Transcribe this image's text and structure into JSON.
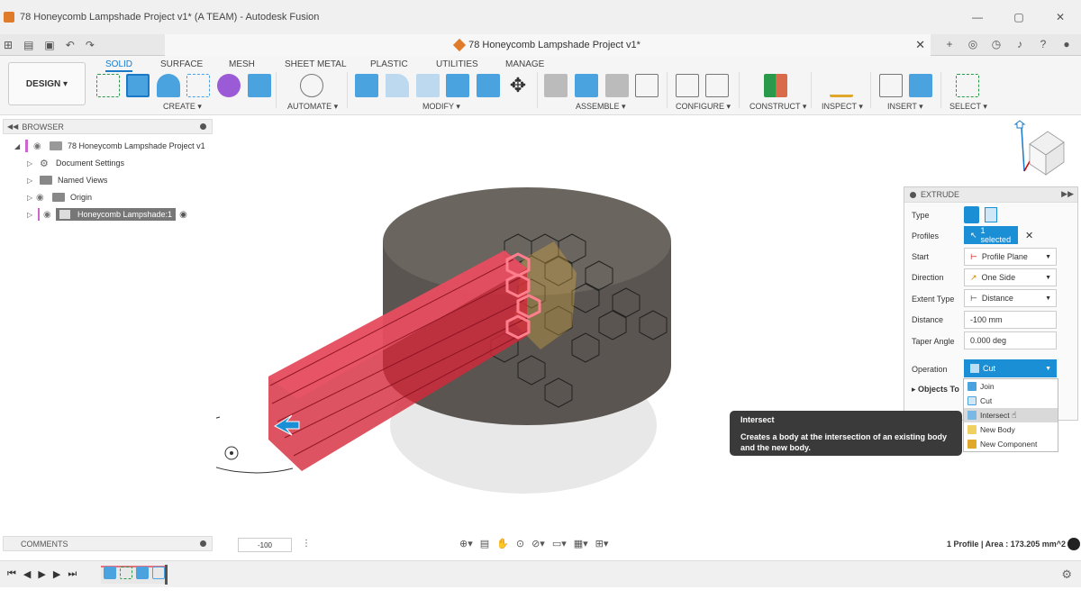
{
  "window": {
    "title": "78 Honeycomb Lampshade Project v1* (A TEAM) - Autodesk Fusion",
    "min": "—",
    "max": "▢",
    "close": "✕"
  },
  "doc_tab": {
    "label": "78 Honeycomb Lampshade Project v1*",
    "close": "✕"
  },
  "ribbon": {
    "workspace": "DESIGN ▾",
    "tabs": [
      "SOLID",
      "SURFACE",
      "MESH",
      "SHEET METAL",
      "PLASTIC",
      "UTILITIES",
      "MANAGE"
    ],
    "active_tab": "SOLID",
    "groups": [
      "CREATE ▾",
      "AUTOMATE ▾",
      "MODIFY ▾",
      "ASSEMBLE ▾",
      "CONFIGURE ▾",
      "CONSTRUCT ▾",
      "INSPECT ▾",
      "INSERT ▾",
      "SELECT ▾"
    ]
  },
  "browser": {
    "header": "BROWSER",
    "items": [
      {
        "label": "78 Honeycomb Lampshade Project v1"
      },
      {
        "label": "Document Settings"
      },
      {
        "label": "Named Views"
      },
      {
        "label": "Origin"
      },
      {
        "label": "Honeycomb Lampshade:1"
      }
    ]
  },
  "comments": {
    "label": "COMMENTS"
  },
  "extrude": {
    "header": "EXTRUDE",
    "rows": {
      "type": "Type",
      "profiles": "Profiles",
      "start": "Start",
      "direction": "Direction",
      "extent_type": "Extent Type",
      "distance": "Distance",
      "taper_angle": "Taper Angle",
      "operation": "Operation",
      "objects_to_cut": "Objects To"
    },
    "values": {
      "profiles": "1 selected",
      "start": "Profile Plane",
      "direction": "One Side",
      "extent_type": "Distance",
      "distance": "-100 mm",
      "taper_angle": "0.000 deg",
      "operation": "Cut"
    },
    "operation_options": [
      "Join",
      "Cut",
      "Intersect",
      "New Body",
      "New Component"
    ],
    "hovered_option": "Intersect"
  },
  "tooltip": {
    "title": "Intersect",
    "body": "Creates a body at the intersection of an existing body and the new body."
  },
  "navbar": {
    "value": "-100",
    "status": "1 Profile | Area : 173.205 mm^2"
  },
  "colors": {
    "accent": "#1a8fd6",
    "brand": "#e07b2a",
    "extrude_red": "#d6283a",
    "cylinder": "#5a5550"
  }
}
